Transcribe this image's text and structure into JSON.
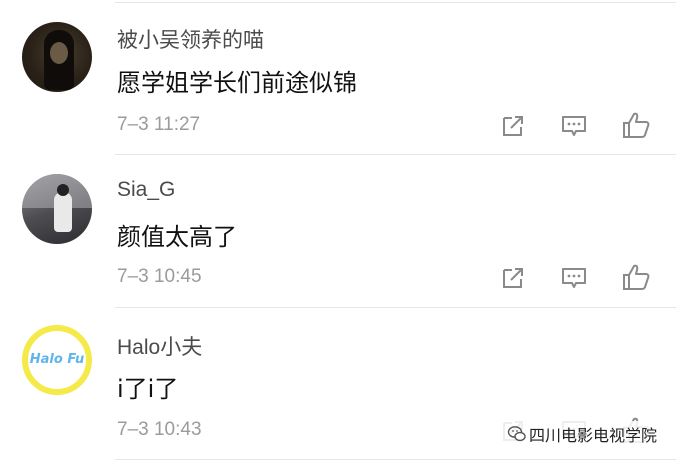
{
  "comments": [
    {
      "username": "被小吴领养的喵",
      "content": "愿学姐学长们前途似锦",
      "time": "7–3 11:27",
      "avatar": "user-photo-dark"
    },
    {
      "username": "Sia_G",
      "content": "颜值太高了",
      "time": "7–3 10:45",
      "avatar": "user-photo-grey"
    },
    {
      "username": "Halo小夫",
      "content": "i了i了",
      "time": "7–3 10:43",
      "avatar": "logo-halo",
      "avatar_text": "Halo Fu"
    }
  ],
  "icons": {
    "share": "share-icon",
    "comment": "comment-icon",
    "like": "like-icon"
  },
  "watermark": {
    "text": "四川电影电视学院",
    "icon": "wechat-icon"
  },
  "colors": {
    "username": "#4b4b4b",
    "content": "#111111",
    "time": "#9b9b9b",
    "icon": "#8a8a8a",
    "divider": "#e6e6e6",
    "avatar_ring": "#f4ea4a",
    "avatar_logo": "#5fb5ea"
  }
}
